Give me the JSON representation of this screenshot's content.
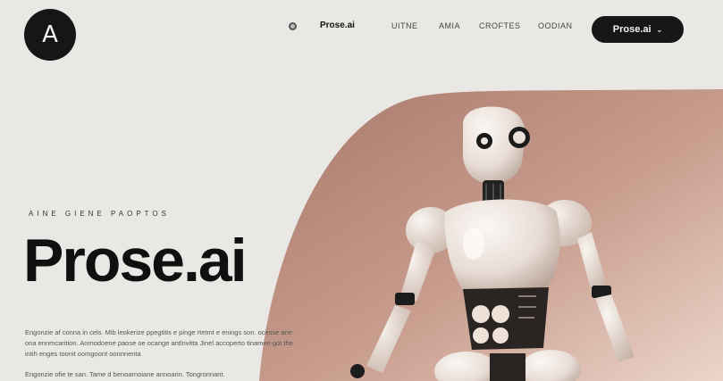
{
  "brand": {
    "logo_letter": "A",
    "name": "Prose.ai"
  },
  "nav": {
    "items": [
      "UITNE",
      "AMIA",
      "CROFTES",
      "OODIAN"
    ]
  },
  "cta": {
    "label": "Prose.ai"
  },
  "hero": {
    "eyebrow": "AINE GIENE PAOPTOS",
    "headline": "Prose.ai",
    "body": "Engonzie af conna in cels. Mib leokerize ppegtitis e pinge rtetmt e enings son. ocesse ane ona ennmcarition. Anmodoene paose oe ocange antlnvitta Jinel accoperto tinamen got the intih enges toonit oomgoont oonnnenta",
    "footnote": "Engonzie ofie te san. Tame d benoarnoiane annoarin. Tongronnant."
  },
  "colors": {
    "background": "#e9e8e4",
    "shape_top": "#b08576",
    "shape_bottom": "#e8cec2",
    "dark": "#161616"
  },
  "icons": {
    "cta_chevron": "chevron-down-icon",
    "nav_dot": "circle-dot-icon"
  }
}
